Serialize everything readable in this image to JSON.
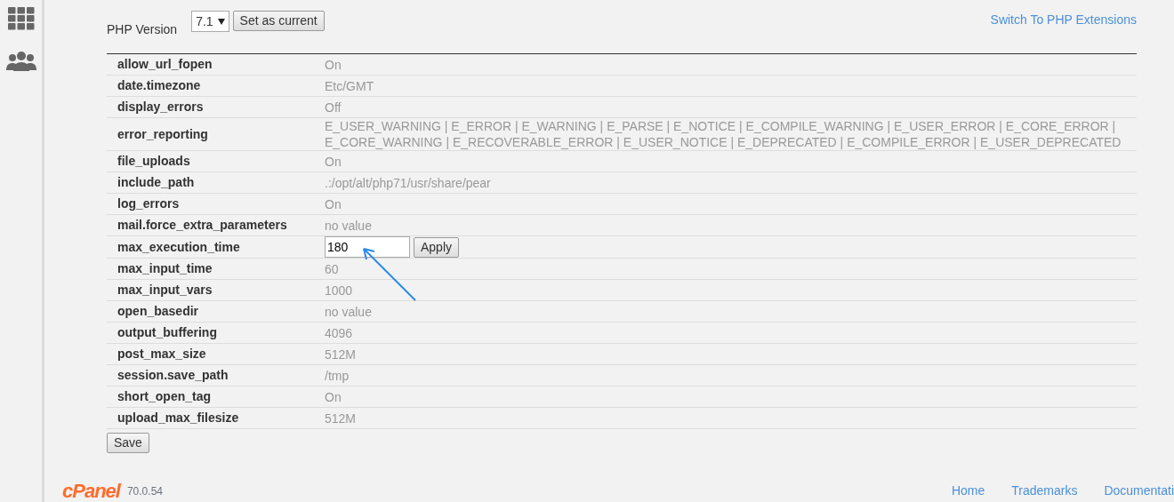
{
  "version_selector": {
    "label": "PHP Version",
    "value": "7.1",
    "button": "Set as current"
  },
  "switch_link": "Switch To PHP Extensions",
  "options": [
    {
      "kind": "text",
      "name": "allow_url_fopen",
      "value": "On"
    },
    {
      "kind": "text",
      "name": "date.timezone",
      "value": "Etc/GMT"
    },
    {
      "kind": "text",
      "name": "display_errors",
      "value": "Off"
    },
    {
      "kind": "text",
      "name": "error_reporting",
      "value": "E_USER_WARNING | E_ERROR | E_WARNING | E_PARSE | E_NOTICE | E_COMPILE_WARNING | E_USER_ERROR | E_CORE_ERROR | E_CORE_WARNING | E_RECOVERABLE_ERROR | E_USER_NOTICE | E_DEPRECATED | E_COMPILE_ERROR | E_USER_DEPRECATED"
    },
    {
      "kind": "text",
      "name": "file_uploads",
      "value": "On"
    },
    {
      "kind": "text",
      "name": "include_path",
      "value": ".:/opt/alt/php71/usr/share/pear"
    },
    {
      "kind": "text",
      "name": "log_errors",
      "value": "On"
    },
    {
      "kind": "text",
      "name": "mail.force_extra_parameters",
      "value": "no value"
    },
    {
      "kind": "input",
      "name": "max_execution_time",
      "value": "180",
      "button": "Apply"
    },
    {
      "kind": "text",
      "name": "max_input_time",
      "value": "60"
    },
    {
      "kind": "text",
      "name": "max_input_vars",
      "value": "1000"
    },
    {
      "kind": "text",
      "name": "open_basedir",
      "value": "no value"
    },
    {
      "kind": "text",
      "name": "output_buffering",
      "value": "4096"
    },
    {
      "kind": "text",
      "name": "post_max_size",
      "value": "512M"
    },
    {
      "kind": "text",
      "name": "session.save_path",
      "value": "/tmp"
    },
    {
      "kind": "text",
      "name": "short_open_tag",
      "value": "On"
    },
    {
      "kind": "text",
      "name": "upload_max_filesize",
      "value": "512M"
    }
  ],
  "save_button": "Save",
  "footer": {
    "logo": "cPanel",
    "version": "70.0.54",
    "links": [
      "Home",
      "Trademarks",
      "Documentati"
    ]
  }
}
